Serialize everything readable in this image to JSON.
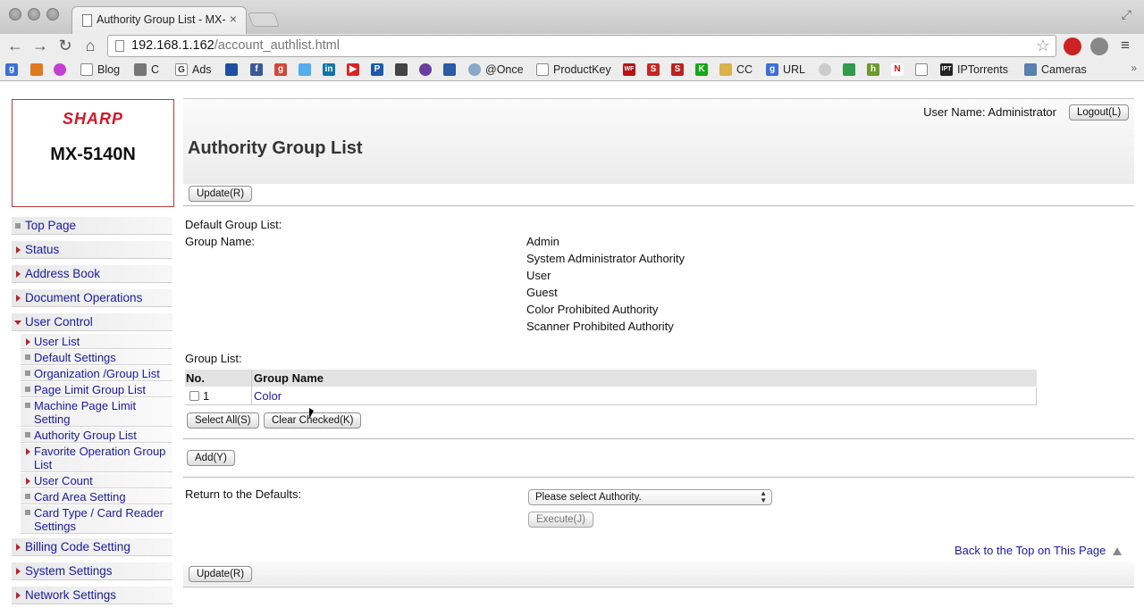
{
  "browser": {
    "tab_title": "Authority Group List - MX-",
    "tab_close": "×",
    "url_host": "192.168.1.162",
    "url_path": "/account_authlist.html",
    "back_icon": "←",
    "forward_icon": "→",
    "reload_icon": "↻",
    "home_icon": "⌂",
    "star_icon": "☆",
    "menu_icon": "≡",
    "bookmarks_more": "»",
    "bookmarks": [
      {
        "label": "Blog",
        "icon": "page-icon"
      },
      {
        "label": "C",
        "icon": "bookmark-icon"
      },
      {
        "label": "Ads",
        "icon": "google-icon"
      },
      {
        "label": "@Once",
        "icon": "globe-icon"
      },
      {
        "label": "ProductKey",
        "icon": "page-icon"
      },
      {
        "label": "CC",
        "icon": "card-icon"
      },
      {
        "label": "URL",
        "icon": "google-icon"
      },
      {
        "label": "IPTorrents",
        "icon": "ipt-icon"
      },
      {
        "label": "Cameras",
        "icon": "camera-icon"
      }
    ]
  },
  "brand": {
    "maker": "SHARP",
    "model": "MX-5140N",
    "maker_color": "#d4182a"
  },
  "sidebar": {
    "items": [
      {
        "label": "Top Page"
      },
      {
        "label": "Status"
      },
      {
        "label": "Address Book"
      },
      {
        "label": "Document Operations"
      },
      {
        "label": "User Control"
      },
      {
        "label": "Billing Code Setting"
      },
      {
        "label": "System Settings"
      },
      {
        "label": "Network Settings"
      }
    ],
    "user_control_sub": [
      {
        "label": "User List"
      },
      {
        "label": "Default Settings"
      },
      {
        "label": "Organization /Group List"
      },
      {
        "label": "Page Limit Group List"
      },
      {
        "label": "Machine Page Limit Setting"
      },
      {
        "label": "Authority Group List"
      },
      {
        "label": "Favorite Operation Group List"
      },
      {
        "label": "User Count"
      },
      {
        "label": "Card Area Setting"
      },
      {
        "label": "Card Type / Card Reader Settings"
      }
    ],
    "link_color": "#1a1aa0"
  },
  "header": {
    "user_name": "User Name: Administrator",
    "logout_label": "Logout(L)"
  },
  "main": {
    "title": "Authority Group List",
    "update_label": "Update(R)",
    "default_group_list_label": "Default Group List:",
    "group_name_label": "Group Name:",
    "default_groups": [
      "Admin",
      "System Administrator Authority",
      "User",
      "Guest",
      "Color Prohibited Authority",
      "Scanner Prohibited Authority"
    ],
    "group_list_label": "Group List:",
    "table": {
      "columns": [
        "No.",
        "Group Name"
      ],
      "rows": [
        {
          "no": "1",
          "name": "Color",
          "checked": false
        }
      ]
    },
    "select_all_label": "Select All(S)",
    "clear_checked_label": "Clear Checked(K)",
    "add_label": "Add(Y)",
    "return_defaults_label": "Return to the Defaults:",
    "authority_select_value": "Please select Authority.",
    "execute_label": "Execute(J)",
    "back_to_top_label": "Back to the Top on This Page"
  }
}
